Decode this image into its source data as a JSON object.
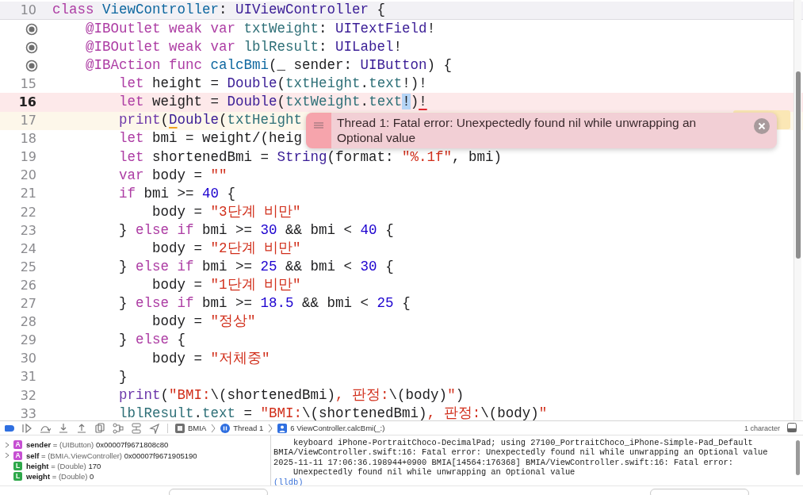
{
  "editor": {
    "lines": [
      {
        "kind": "number",
        "number": "10",
        "pinned": true,
        "error": false,
        "current": false,
        "tokens": [
          {
            "kind": "keyword",
            "text": "class"
          },
          {
            "kind": "decl",
            "text": " ViewController"
          },
          {
            "kind": "plain",
            "text": ": "
          },
          {
            "kind": "type",
            "text": "UIViewController"
          },
          {
            "kind": "plain",
            "text": " {"
          }
        ]
      },
      {
        "kind": "outlet",
        "connected": true,
        "pinned": false,
        "error": false,
        "current": false,
        "tokens": [
          {
            "kind": "keyword",
            "text": "    @IBOutlet weak var"
          },
          {
            "kind": "prop",
            "text": " txtWeight"
          },
          {
            "kind": "plain",
            "text": ": "
          },
          {
            "kind": "type",
            "text": "UITextField"
          },
          {
            "kind": "plain",
            "text": "!"
          }
        ]
      },
      {
        "kind": "outlet",
        "connected": true,
        "pinned": false,
        "error": false,
        "current": false,
        "tokens": [
          {
            "kind": "keyword",
            "text": "    @IBOutlet weak var"
          },
          {
            "kind": "prop",
            "text": " lblResult"
          },
          {
            "kind": "plain",
            "text": ": "
          },
          {
            "kind": "type",
            "text": "UILabel"
          },
          {
            "kind": "plain",
            "text": "!"
          }
        ]
      },
      {
        "kind": "outlet",
        "connected": true,
        "pinned": false,
        "error": false,
        "current": false,
        "tokens": [
          {
            "kind": "keyword",
            "text": "    @IBAction func"
          },
          {
            "kind": "decl",
            "text": " calcBmi"
          },
          {
            "kind": "plain",
            "text": "(_ sender: "
          },
          {
            "kind": "type",
            "text": "UIButton"
          },
          {
            "kind": "plain",
            "text": ") {"
          }
        ]
      },
      {
        "kind": "number",
        "number": "15",
        "pinned": false,
        "error": false,
        "current": false,
        "tokens": [
          {
            "kind": "keyword",
            "text": "        let"
          },
          {
            "kind": "plain",
            "text": " height = "
          },
          {
            "kind": "type",
            "text": "Double"
          },
          {
            "kind": "plain",
            "text": "("
          },
          {
            "kind": "prop",
            "text": "txtHeight"
          },
          {
            "kind": "plain",
            "text": "."
          },
          {
            "kind": "prop",
            "text": "text"
          },
          {
            "kind": "plain",
            "text": "!)!"
          }
        ]
      },
      {
        "kind": "number",
        "number": "16",
        "pinned": false,
        "error": true,
        "current": false,
        "tokens": [
          {
            "kind": "keyword",
            "text": "        let"
          },
          {
            "kind": "plain",
            "text": " weight = "
          },
          {
            "kind": "type",
            "text": "Double"
          },
          {
            "kind": "plain",
            "text": "("
          },
          {
            "kind": "prop",
            "text": "txtWeight"
          },
          {
            "kind": "plain",
            "text": "."
          },
          {
            "kind": "prop",
            "text": "text"
          },
          {
            "kind": "selection",
            "text": "!"
          },
          {
            "kind": "plain",
            "text": ")"
          },
          {
            "kind": "errormark",
            "text": "!"
          }
        ]
      },
      {
        "kind": "number",
        "number": "17",
        "pinned": false,
        "error": false,
        "current": true,
        "tokens": [
          {
            "kind": "function",
            "text": "        print"
          },
          {
            "kind": "plain",
            "text": "("
          },
          {
            "kind": "warnmark",
            "text": "D"
          },
          {
            "kind": "type",
            "text": "ouble"
          },
          {
            "kind": "plain",
            "text": "("
          },
          {
            "kind": "prop",
            "text": "txtHeight"
          }
        ]
      },
      {
        "kind": "number",
        "number": "18",
        "pinned": false,
        "error": false,
        "current": false,
        "tokens": [
          {
            "kind": "keyword",
            "text": "        let"
          },
          {
            "kind": "plain",
            "text": " bmi = weight/(heig"
          }
        ]
      },
      {
        "kind": "number",
        "number": "19",
        "pinned": false,
        "error": false,
        "current": false,
        "tokens": [
          {
            "kind": "keyword",
            "text": "        let"
          },
          {
            "kind": "plain",
            "text": " shortenedBmi = "
          },
          {
            "kind": "type",
            "text": "String"
          },
          {
            "kind": "plain",
            "text": "(format: "
          },
          {
            "kind": "string",
            "text": "\"%.1f\""
          },
          {
            "kind": "plain",
            "text": ", bmi)"
          }
        ]
      },
      {
        "kind": "number",
        "number": "20",
        "pinned": false,
        "error": false,
        "current": false,
        "tokens": [
          {
            "kind": "keyword",
            "text": "        var"
          },
          {
            "kind": "plain",
            "text": " body = "
          },
          {
            "kind": "string",
            "text": "\"\""
          }
        ]
      },
      {
        "kind": "number",
        "number": "21",
        "pinned": false,
        "error": false,
        "current": false,
        "tokens": [
          {
            "kind": "keyword",
            "text": "        if"
          },
          {
            "kind": "plain",
            "text": " bmi >= "
          },
          {
            "kind": "number",
            "text": "40"
          },
          {
            "kind": "plain",
            "text": " {"
          }
        ]
      },
      {
        "kind": "number",
        "number": "22",
        "pinned": false,
        "error": false,
        "current": false,
        "tokens": [
          {
            "kind": "plain",
            "text": "            body = "
          },
          {
            "kind": "string",
            "text": "\"3단계 비만\""
          }
        ]
      },
      {
        "kind": "number",
        "number": "23",
        "pinned": false,
        "error": false,
        "current": false,
        "tokens": [
          {
            "kind": "plain",
            "text": "        } "
          },
          {
            "kind": "keyword",
            "text": "else if"
          },
          {
            "kind": "plain",
            "text": " bmi >= "
          },
          {
            "kind": "number",
            "text": "30"
          },
          {
            "kind": "plain",
            "text": " && bmi < "
          },
          {
            "kind": "number",
            "text": "40"
          },
          {
            "kind": "plain",
            "text": " {"
          }
        ]
      },
      {
        "kind": "number",
        "number": "24",
        "pinned": false,
        "error": false,
        "current": false,
        "tokens": [
          {
            "kind": "plain",
            "text": "            body = "
          },
          {
            "kind": "string",
            "text": "\"2단계 비만\""
          }
        ]
      },
      {
        "kind": "number",
        "number": "25",
        "pinned": false,
        "error": false,
        "current": false,
        "tokens": [
          {
            "kind": "plain",
            "text": "        } "
          },
          {
            "kind": "keyword",
            "text": "else if"
          },
          {
            "kind": "plain",
            "text": " bmi >= "
          },
          {
            "kind": "number",
            "text": "25"
          },
          {
            "kind": "plain",
            "text": " && bmi < "
          },
          {
            "kind": "number",
            "text": "30"
          },
          {
            "kind": "plain",
            "text": " {"
          }
        ]
      },
      {
        "kind": "number",
        "number": "26",
        "pinned": false,
        "error": false,
        "current": false,
        "tokens": [
          {
            "kind": "plain",
            "text": "            body = "
          },
          {
            "kind": "string",
            "text": "\"1단계 비만\""
          }
        ]
      },
      {
        "kind": "number",
        "number": "27",
        "pinned": false,
        "error": false,
        "current": false,
        "tokens": [
          {
            "kind": "plain",
            "text": "        } "
          },
          {
            "kind": "keyword",
            "text": "else if"
          },
          {
            "kind": "plain",
            "text": " bmi >= "
          },
          {
            "kind": "number",
            "text": "18.5"
          },
          {
            "kind": "plain",
            "text": " && bmi < "
          },
          {
            "kind": "number",
            "text": "25"
          },
          {
            "kind": "plain",
            "text": " {"
          }
        ]
      },
      {
        "kind": "number",
        "number": "28",
        "pinned": false,
        "error": false,
        "current": false,
        "tokens": [
          {
            "kind": "plain",
            "text": "            body = "
          },
          {
            "kind": "string",
            "text": "\"정상\""
          }
        ]
      },
      {
        "kind": "number",
        "number": "29",
        "pinned": false,
        "error": false,
        "current": false,
        "tokens": [
          {
            "kind": "plain",
            "text": "        } "
          },
          {
            "kind": "keyword",
            "text": "else"
          },
          {
            "kind": "plain",
            "text": " {"
          }
        ]
      },
      {
        "kind": "number",
        "number": "30",
        "pinned": false,
        "error": false,
        "current": false,
        "tokens": [
          {
            "kind": "plain",
            "text": "            body = "
          },
          {
            "kind": "string",
            "text": "\"저체중\""
          }
        ]
      },
      {
        "kind": "number",
        "number": "31",
        "pinned": false,
        "error": false,
        "current": false,
        "tokens": [
          {
            "kind": "plain",
            "text": "        }"
          }
        ]
      },
      {
        "kind": "number",
        "number": "32",
        "pinned": false,
        "error": false,
        "current": false,
        "tokens": [
          {
            "kind": "function",
            "text": "        print"
          },
          {
            "kind": "plain",
            "text": "("
          },
          {
            "kind": "string",
            "text": "\"BMI:"
          },
          {
            "kind": "plain",
            "text": "\\(shortenedBmi)"
          },
          {
            "kind": "string",
            "text": ", 판정:"
          },
          {
            "kind": "plain",
            "text": "\\(body)"
          },
          {
            "kind": "string",
            "text": "\""
          },
          {
            "kind": "plain",
            "text": ")"
          }
        ]
      },
      {
        "kind": "number",
        "number": "33",
        "pinned": false,
        "error": false,
        "current": false,
        "tokens": [
          {
            "kind": "prop",
            "text": "        lblResult"
          },
          {
            "kind": "plain",
            "text": "."
          },
          {
            "kind": "prop",
            "text": "text"
          },
          {
            "kind": "plain",
            "text": " = "
          },
          {
            "kind": "string",
            "text": "\"BMI:"
          },
          {
            "kind": "plain",
            "text": "\\(shortenedBmi)"
          },
          {
            "kind": "string",
            "text": ", 판정:"
          },
          {
            "kind": "plain",
            "text": "\\(body)"
          },
          {
            "kind": "string",
            "text": "\""
          }
        ]
      }
    ],
    "error_popup": {
      "message": "Thread 1: Fatal error: Unexpectedly found nil while unwrapping an Optional value"
    }
  },
  "debug_bar": {
    "breakpoints_active": true,
    "breadcrumbs": [
      {
        "kind": "app",
        "label": "BMIA"
      },
      {
        "kind": "thread",
        "label": "Thread 1"
      },
      {
        "kind": "frame",
        "label": "6 ViewController.calcBmi(_:)"
      }
    ],
    "selection_info": "1 character"
  },
  "variables": [
    {
      "badge": "A",
      "color": "#c64fd2",
      "expandable": true,
      "label": "**sender** =",
      "type": "(UIButton)",
      "value": "0x00007f9671808c80"
    },
    {
      "badge": "A",
      "color": "#c64fd2",
      "expandable": true,
      "label": "**self** =",
      "type": "(BMIA.ViewController)",
      "value": "0x00007f9671905190"
    },
    {
      "badge": "L",
      "color": "#2ea84a",
      "expandable": false,
      "label": "**height** =",
      "type": "(Double)",
      "value": "170"
    },
    {
      "badge": "L",
      "color": "#2ea84a",
      "expandable": false,
      "label": "**weight** =",
      "type": "(Double)",
      "value": "0"
    }
  ],
  "console": {
    "lines": [
      "    keyboard iPhone-PortraitChoco-DecimalPad; using 27100_PortraitChoco_iPhone-Simple-Pad_Default",
      "BMIA/ViewController.swift:16: Fatal error: Unexpectedly found nil while unwrapping an Optional value",
      "2025-11-11 17:06:36.198944+0900 BMIA[14564:176368] BMIA/ViewController.swift:16: Fatal error:",
      "    Unexpectedly found nil while unwrapping an Optional value"
    ],
    "prompt": "(lldb)"
  }
}
